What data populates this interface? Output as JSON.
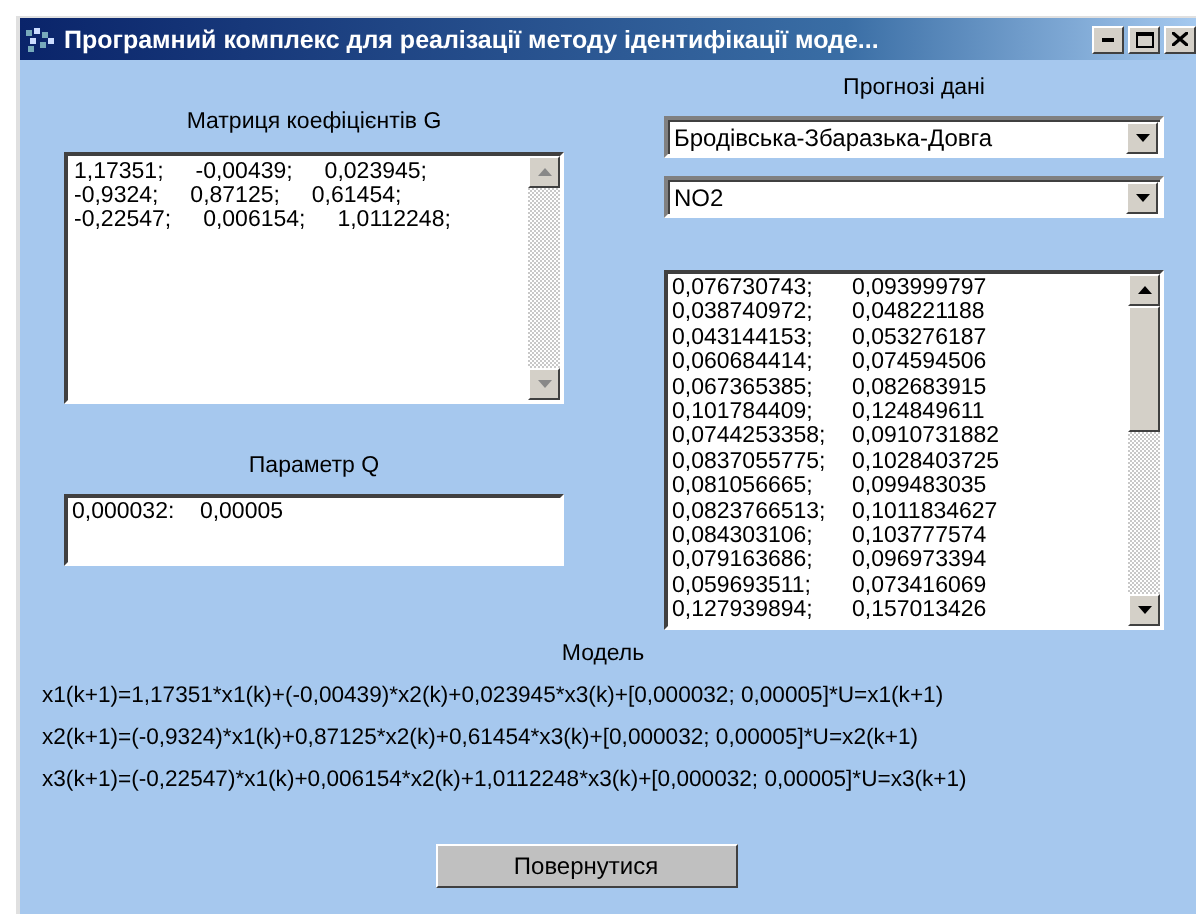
{
  "window": {
    "title": "Програмний комплекс для реалізації методу ідентифікації моде..."
  },
  "matrix": {
    "label": "Матриця коефіцієнтів G",
    "lines": [
      "1,17351;     -0,00439;     0,023945;",
      "-0,9324;     0,87125;     0,61454;",
      "-0,22547;     0,006154;     1,0112248;"
    ]
  },
  "parameter": {
    "label": "Параметр Q",
    "value": "0,000032:    0,00005"
  },
  "forecast": {
    "label": "Прогнозі дані",
    "region": "Бродівська-Збаразька-Довга",
    "substance": "NO2",
    "rows": [
      [
        "0,076730743;",
        "0,093999797"
      ],
      [
        "0,038740972;",
        "0,048221188"
      ],
      [
        "0,043144153;",
        "0,053276187"
      ],
      [
        "0,060684414;",
        "0,074594506"
      ],
      [
        "0,067365385;",
        "0,082683915"
      ],
      [
        "0,101784409;",
        "0,124849611"
      ],
      [
        "0,0744253358;",
        "0,0910731882"
      ],
      [
        "0,0837055775;",
        "0,1028403725"
      ],
      [
        "0,081056665;",
        "0,099483035"
      ],
      [
        "0,0823766513;",
        "0,1011834627"
      ],
      [
        "0,084303106;",
        "0,103777574"
      ],
      [
        "0,079163686;",
        "0,096973394"
      ],
      [
        "0,059693511;",
        "0,073416069"
      ],
      [
        "0,127939894;",
        "0,157013426"
      ]
    ]
  },
  "model": {
    "label": "Модель",
    "equations": [
      "x1(k+1)=1,17351*x1(k)+(-0,00439)*x2(k)+0,023945*x3(k)+[0,000032; 0,00005]*U=x1(k+1)",
      "x2(k+1)=(-0,9324)*x1(k)+0,87125*x2(k)+0,61454*x3(k)+[0,000032; 0,00005]*U=x2(k+1)",
      "x3(k+1)=(-0,22547)*x1(k)+0,006154*x2(k)+1,0112248*x3(k)+[0,000032; 0,00005]*U=x3(k+1)"
    ]
  },
  "buttons": [
    "Повернутися"
  ]
}
